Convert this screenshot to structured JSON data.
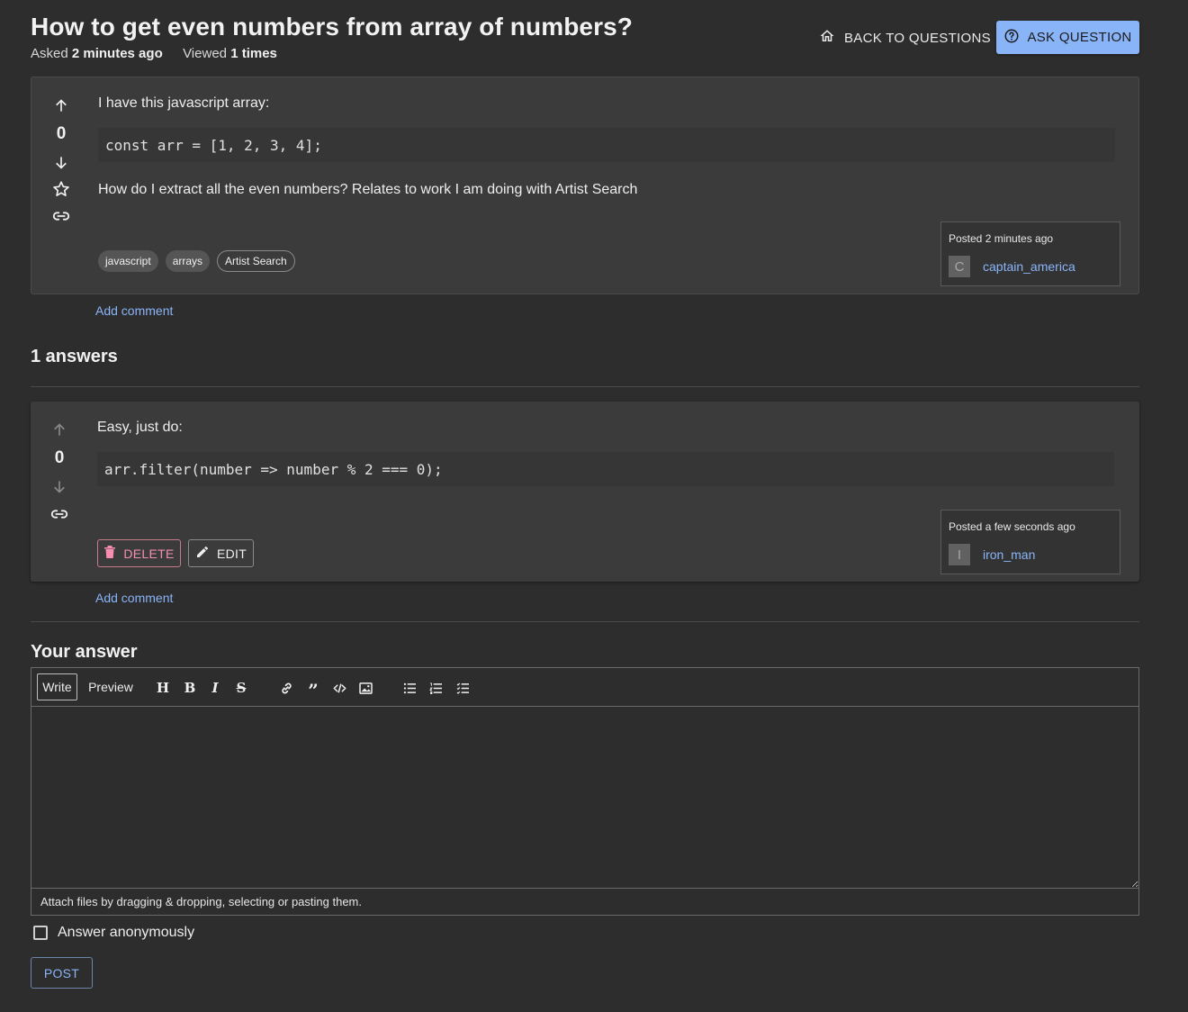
{
  "question": {
    "title": "How to get even numbers from array of numbers?",
    "asked_label": "Asked",
    "asked_value": "2 minutes ago",
    "viewed_label": "Viewed",
    "viewed_value": "1 times",
    "score": "0",
    "body_intro": "I have this javascript array:",
    "code": "const arr = [1, 2, 3, 4];",
    "body_question": "How do I extract all the even numbers? Relates to work I am doing with Artist Search",
    "tags": [
      {
        "label": "javascript"
      },
      {
        "label": "arrays"
      },
      {
        "label": "Artist Search"
      }
    ],
    "posted": "Posted 2 minutes ago",
    "author_initial": "C",
    "author": "captain_america",
    "add_comment": "Add comment"
  },
  "header": {
    "back_label": "BACK TO QUESTIONS",
    "ask_label": "ASK QUESTION"
  },
  "answers_heading": "1 answers",
  "answer": {
    "score": "0",
    "body": "Easy, just do:",
    "code": "arr.filter(number => number % 2 === 0);",
    "delete_label": "DELETE",
    "edit_label": "EDIT",
    "posted": "Posted a few seconds ago",
    "author_initial": "I",
    "author": "iron_man",
    "add_comment": "Add comment"
  },
  "your_answer": {
    "heading": "Your answer",
    "tab_write": "Write",
    "tab_preview": "Preview",
    "toolbar_icons": [
      "heading-icon",
      "bold-icon",
      "italic-icon",
      "strikethrough-icon",
      "link-icon",
      "quote-icon",
      "code-icon",
      "image-icon",
      "bulleted-list-icon",
      "numbered-list-icon",
      "task-list-icon"
    ],
    "textarea_value": "",
    "attach_text": "Attach files by dragging & dropping, selecting or pasting them.",
    "anonymous_label": "Answer anonymously",
    "anonymous_checked": false,
    "post_label": "POST"
  },
  "colors": {
    "background": "#2d2d2d",
    "card": "#3b3b3b",
    "accent": "#8ab4f8",
    "delete": "#f48fb1"
  }
}
